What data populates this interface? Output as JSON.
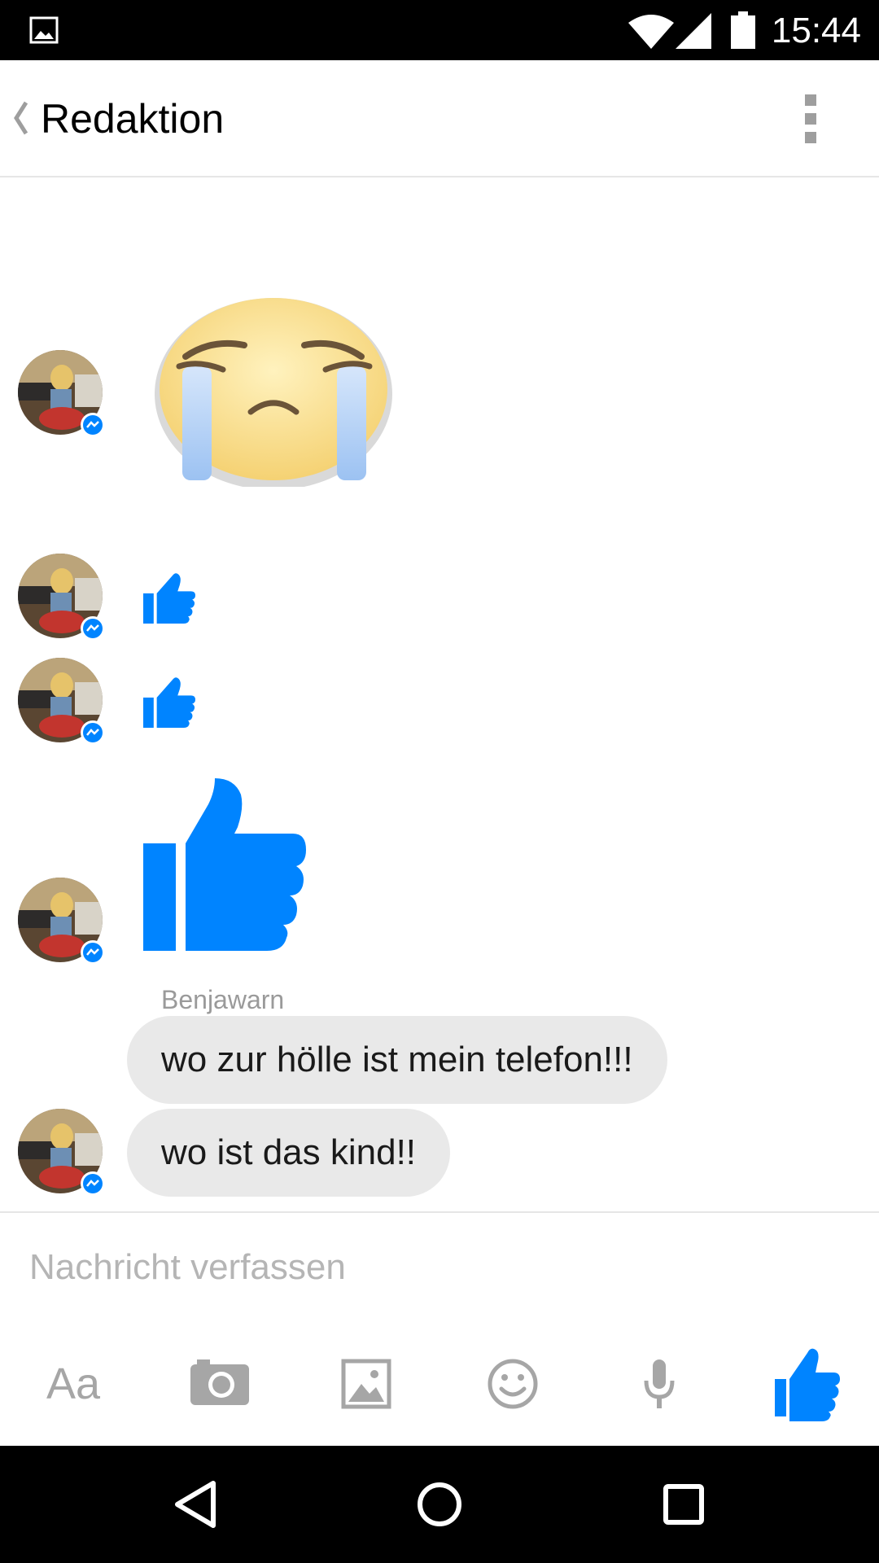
{
  "status_bar": {
    "time": "15:44",
    "icons": [
      "image-notification-icon",
      "wifi-icon",
      "cell-signal-icon",
      "battery-icon"
    ]
  },
  "header": {
    "title": "Redaktion",
    "back_icon": "chevron-left-icon",
    "menu_icon": "overflow-menu-icon"
  },
  "messages": [
    {
      "type": "sticker",
      "sticker": "crying-face"
    },
    {
      "type": "like",
      "size": "small"
    },
    {
      "type": "like",
      "size": "small"
    },
    {
      "type": "like",
      "size": "large"
    },
    {
      "type": "text",
      "sender": "Benjawarn",
      "text": "wo zur hölle ist mein telefon!!!"
    },
    {
      "type": "text",
      "text": "wo ist das kind!!"
    }
  ],
  "composer": {
    "placeholder": "Nachricht verfassen",
    "toolbar": {
      "text_format_label": "Aa",
      "icons": [
        "text-format-icon",
        "camera-icon",
        "gallery-icon",
        "emoji-icon",
        "microphone-icon",
        "like-button-icon"
      ]
    }
  },
  "nav_bar": {
    "icons": [
      "back-nav-icon",
      "home-nav-icon",
      "recents-nav-icon"
    ]
  },
  "colors": {
    "accent": "#0084ff",
    "bubble": "#e9e9e9",
    "status_bar": "#000000",
    "muted_text": "#9a9a9a"
  }
}
